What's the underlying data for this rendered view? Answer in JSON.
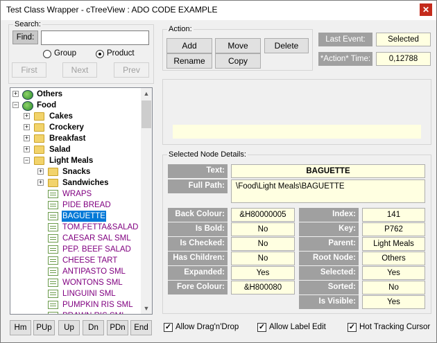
{
  "window": {
    "title": "Test Class Wrapper - cTreeView : ADO CODE EXAMPLE",
    "close_glyph": "✕"
  },
  "search": {
    "legend": "Search:",
    "find_label": "Find:",
    "find_value": "",
    "radio_group": "Group",
    "radio_product": "Product",
    "selected_radio": "Product",
    "first": "First",
    "next": "Next",
    "prev": "Prev"
  },
  "action": {
    "legend": "Action:",
    "add": "Add",
    "move": "Move",
    "delete": "Delete",
    "rename": "Rename",
    "copy": "Copy"
  },
  "last_event": {
    "label": "Last Event:",
    "value": "Selected"
  },
  "action_time": {
    "label": "*Action* Time:",
    "value": "0,12788"
  },
  "tree": {
    "rows": [
      {
        "text": "Others",
        "kind": "root"
      },
      {
        "text": "Food",
        "kind": "root"
      },
      {
        "text": "Cakes",
        "kind": "folder"
      },
      {
        "text": "Crockery",
        "kind": "folder"
      },
      {
        "text": "Breakfast",
        "kind": "folder"
      },
      {
        "text": "Salad",
        "kind": "folder"
      },
      {
        "text": "Light Meals",
        "kind": "folder"
      },
      {
        "text": "Snacks",
        "kind": "subfolder"
      },
      {
        "text": "Sandwiches",
        "kind": "subfolder"
      },
      {
        "text": "WRAPS",
        "kind": "leaf"
      },
      {
        "text": "PIDE BREAD",
        "kind": "leaf"
      },
      {
        "text": "BAGUETTE",
        "kind": "leaf"
      },
      {
        "text": "TOM,FETTA&SALAD",
        "kind": "leaf"
      },
      {
        "text": "CAESAR SAL SML",
        "kind": "leaf"
      },
      {
        "text": "PEP. BEEF SALAD",
        "kind": "leaf"
      },
      {
        "text": "CHEESE TART",
        "kind": "leaf"
      },
      {
        "text": "ANTIPASTO SML",
        "kind": "leaf"
      },
      {
        "text": "WONTONS SML",
        "kind": "leaf"
      },
      {
        "text": "LINGUINI SML",
        "kind": "leaf"
      },
      {
        "text": "PUMPKIN RIS SML",
        "kind": "leaf"
      },
      {
        "text": "PRAWN RIS SML",
        "kind": "leaf"
      }
    ],
    "selected_index": 11
  },
  "nav_buttons": [
    "Hm",
    "PUp",
    "Up",
    "Dn",
    "PDn",
    "End"
  ],
  "details": {
    "legend": "Selected Node Details:",
    "text_label": "Text:",
    "text_value": "BAGUETTE",
    "fullpath_label": "Full Path:",
    "fullpath_value": "\\Food\\Light Meals\\BAGUETTE",
    "left": [
      {
        "label": "Back Colour:",
        "value": "&H80000005"
      },
      {
        "label": "Is Bold:",
        "value": "No"
      },
      {
        "label": "Is Checked:",
        "value": "No"
      },
      {
        "label": "Has Children:",
        "value": "No"
      },
      {
        "label": "Expanded:",
        "value": "Yes"
      },
      {
        "label": "Fore Colour:",
        "value": "&H800080"
      }
    ],
    "right": [
      {
        "label": "Index:",
        "value": "141"
      },
      {
        "label": "Key:",
        "value": "P762"
      },
      {
        "label": "Parent:",
        "value": "Light Meals"
      },
      {
        "label": "Root Node:",
        "value": "Others"
      },
      {
        "label": "Selected:",
        "value": "Yes"
      },
      {
        "label": "Sorted:",
        "value": "No"
      },
      {
        "label": "Is Visible:",
        "value": "Yes"
      }
    ]
  },
  "options": {
    "drag_drop": "Allow Drag'n'Drop",
    "label_edit": "Allow Label Edit",
    "hot_tracking": "Hot Tracking Cursor",
    "check_glyph": "✓"
  }
}
